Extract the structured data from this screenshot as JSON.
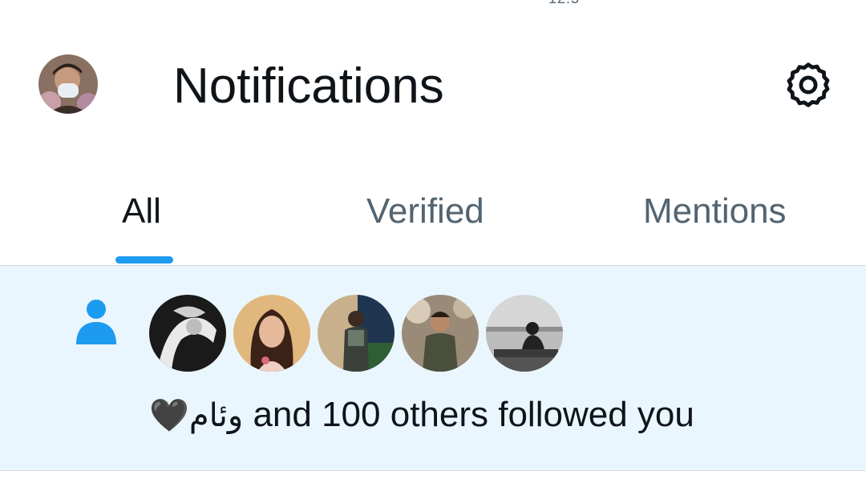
{
  "status_bar": {
    "peek_text": "12:5"
  },
  "header": {
    "title": "Notifications",
    "settings_icon": "gear-icon",
    "avatar_icon": "user-avatar"
  },
  "tabs": [
    {
      "label": "All",
      "active": true
    },
    {
      "label": "Verified",
      "active": false
    },
    {
      "label": "Mentions",
      "active": false
    }
  ],
  "colors": {
    "accent": "#1d9bf0",
    "notification_bg": "#eaf6fd",
    "text_primary": "#0f1419",
    "text_secondary": "#536471"
  },
  "notification": {
    "type_icon": "person-icon",
    "follower_avatars": [
      "follower-1",
      "follower-2",
      "follower-3",
      "follower-4",
      "follower-5"
    ],
    "name": "وئام",
    "heart": "🖤",
    "text": " and 100 others followed you"
  }
}
